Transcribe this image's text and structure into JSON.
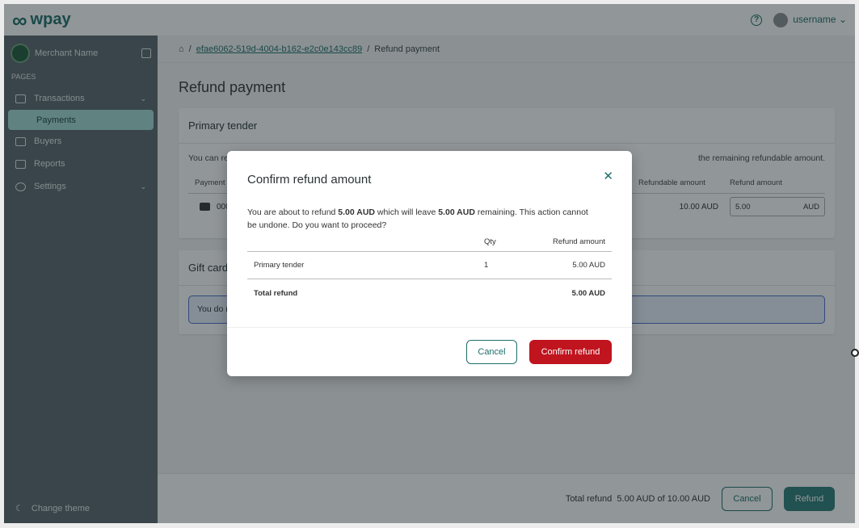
{
  "header": {
    "brand": "wpay",
    "help_icon": "help-circle-icon",
    "username": "username"
  },
  "sidebar": {
    "merchant": "Merchant Name",
    "section": "PAGES",
    "items": [
      {
        "label": "Transactions",
        "icon": "card-icon",
        "expandable": true
      },
      {
        "label": "Payments",
        "active": true
      },
      {
        "label": "Buyers",
        "icon": "contact-icon"
      },
      {
        "label": "Reports",
        "icon": "clipboard-icon"
      },
      {
        "label": "Settings",
        "icon": "gear-icon",
        "expandable": true
      }
    ],
    "theme": "Change theme"
  },
  "breadcrumb": {
    "id": "efae6062-519d-4004-b162-e2c0e143cc89",
    "current": "Refund payment"
  },
  "page": {
    "title": "Refund payment",
    "primary": {
      "title": "Primary tender",
      "text": "You can re",
      "text_end": "the remaining refundable amount.",
      "cols": [
        "Payment",
        "Refundable amount",
        "Refund amount"
      ],
      "row": {
        "payment": "000",
        "refundable": "10.00 AUD",
        "refund_value": "5.00",
        "currency": "AUD"
      }
    },
    "gift": {
      "title": "Gift card",
      "text": "You do n"
    }
  },
  "footer": {
    "total_label": "Total refund",
    "total_value": "5.00 AUD of 10.00 AUD",
    "cancel": "Cancel",
    "refund": "Refund"
  },
  "modal": {
    "title": "Confirm refund amount",
    "t1": "You are about to refund ",
    "amt": "5.00 AUD",
    "t2": " which will leave ",
    "rem": "5.00 AUD",
    "t3": " remaining. This action cannot be undone. Do you want to proceed?",
    "cols": [
      "",
      "Qty",
      "Refund amount"
    ],
    "rows": [
      {
        "name": "Primary tender",
        "qty": "1",
        "amount": "5.00 AUD"
      }
    ],
    "total": {
      "label": "Total refund",
      "amount": "5.00 AUD"
    },
    "cancel": "Cancel",
    "confirm": "Confirm refund"
  },
  "colors": {
    "brand": "#1e6e6a",
    "danger": "#c0141f"
  }
}
